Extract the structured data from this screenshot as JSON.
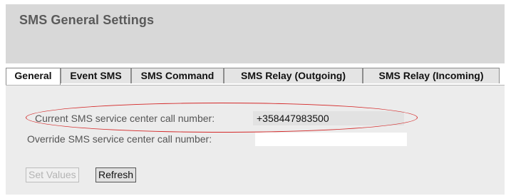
{
  "header": {
    "title": "SMS General Settings"
  },
  "tabs": [
    {
      "label": "General",
      "active": true
    },
    {
      "label": "Event SMS",
      "active": false
    },
    {
      "label": "SMS Command",
      "active": false
    },
    {
      "label": "SMS Relay (Outgoing)",
      "active": false
    },
    {
      "label": "SMS Relay (Incoming)",
      "active": false
    }
  ],
  "form": {
    "current_label": "Current SMS service center call number:",
    "current_value": "+358447983500",
    "override_label": "Override SMS service center call number:",
    "override_value": ""
  },
  "buttons": {
    "set_values": "Set Values",
    "refresh": "Refresh"
  },
  "colors": {
    "header_bg": "#d8d8d8",
    "panel_bg": "#ececec",
    "highlight_ellipse": "#d42828"
  }
}
